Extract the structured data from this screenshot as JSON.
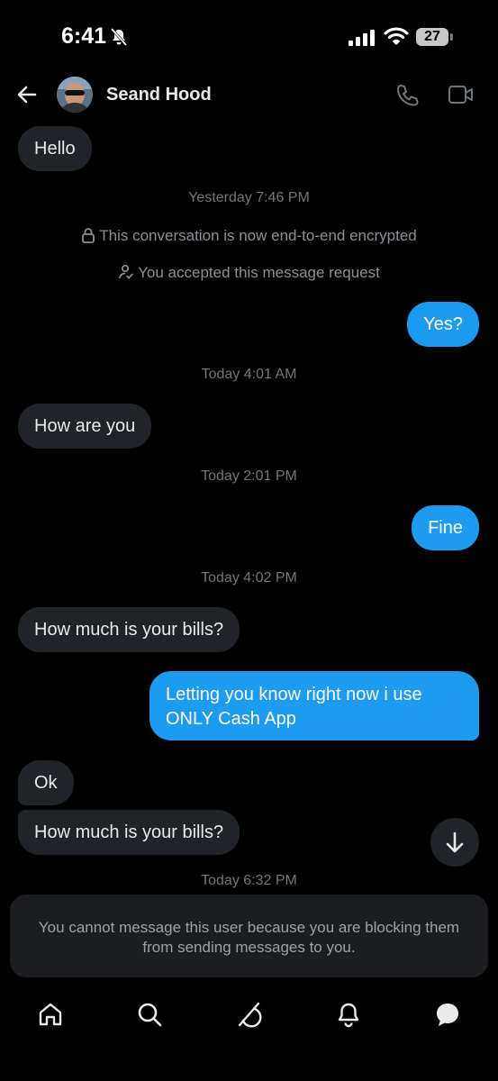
{
  "status_bar": {
    "time": "6:41",
    "battery": "27"
  },
  "header": {
    "contact_name": "Seand Hood"
  },
  "messages": [
    {
      "side": "in",
      "text": "Hello"
    },
    {
      "type": "timestamp",
      "text": "Yesterday 7:46 PM"
    },
    {
      "type": "system",
      "icon": "lock-icon",
      "text": "This conversation is now end-to-end encrypted"
    },
    {
      "type": "system",
      "icon": "user-check-icon",
      "text": "You accepted this message request"
    },
    {
      "side": "out",
      "text": "Yes?"
    },
    {
      "type": "timestamp",
      "text": "Today 4:01 AM"
    },
    {
      "side": "in",
      "text": "How are you"
    },
    {
      "type": "timestamp",
      "text": "Today 2:01 PM"
    },
    {
      "side": "out",
      "text": "Fine"
    },
    {
      "type": "timestamp",
      "text": "Today 4:02 PM"
    },
    {
      "side": "in",
      "text": "How much is your bills?"
    },
    {
      "side": "out",
      "text": "Letting you know right now i use ONLY Cash App"
    },
    {
      "side": "in",
      "text": "Ok"
    },
    {
      "side": "in",
      "text": "How much is your bills?"
    },
    {
      "type": "timestamp",
      "text": "Today 6:32 PM"
    }
  ],
  "blocked_notice": "You cannot message this user because you are blocking them from sending messages to you.",
  "bottom_nav": [
    "home-icon",
    "search-icon",
    "grok-icon",
    "notifications-icon",
    "messages-icon"
  ]
}
